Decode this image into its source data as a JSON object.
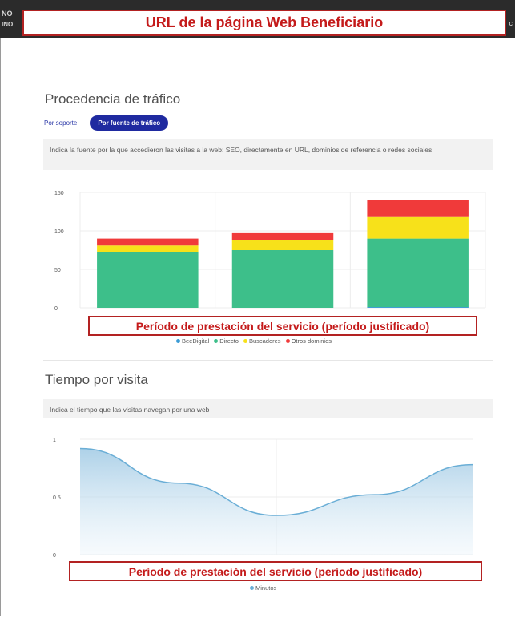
{
  "header": {
    "edge_left_top": "NO",
    "edge_left_bottom": "INO",
    "edge_right": "c",
    "url_banner": "URL de la página Web Beneficiario"
  },
  "traffic": {
    "title": "Procedencia de tráfico",
    "tabs": [
      {
        "label": "Por soporte",
        "active": false
      },
      {
        "label": "Por fuente de tráfico",
        "active": true
      }
    ],
    "info": "Indica la fuente por la que accedieron las visitas a la web: SEO, directamente en URL, dominios de referencia o redes sociales",
    "period_banner": "Período de prestación del servicio (período justificado)"
  },
  "visit_time": {
    "title": "Tiempo por visita",
    "info": "Indica el tiempo que las visitas navegan por una web",
    "period_banner": "Período de prestación del servicio (período justificado)"
  },
  "colors": {
    "accent": "#1f2aa0",
    "banner_red": "#c41a1a",
    "green": "#3dbf8a",
    "yellow": "#f7e11a",
    "red": "#f03a3a",
    "blue": "#3a9bd5",
    "area_line": "#6aaed6"
  },
  "chart_data": [
    {
      "type": "bar",
      "stacked": true,
      "categories": [
        "",
        "",
        ""
      ],
      "series": [
        {
          "name": "BeeDigital",
          "color": "#3a9bd5",
          "values": [
            0,
            0,
            1
          ]
        },
        {
          "name": "Directo",
          "color": "#3dbf8a",
          "values": [
            72,
            75,
            89
          ]
        },
        {
          "name": "Buscadores",
          "color": "#f7e11a",
          "values": [
            9,
            13,
            28
          ]
        },
        {
          "name": "Otros dominios",
          "color": "#f03a3a",
          "values": [
            9,
            9,
            22
          ]
        }
      ],
      "ylim": [
        0,
        150
      ],
      "yticks": [
        0,
        50,
        100,
        150
      ],
      "grid": true,
      "legend": "bottom"
    },
    {
      "type": "area",
      "x": [
        0,
        0.25,
        0.5,
        0.75,
        1
      ],
      "series": [
        {
          "name": "Minutos",
          "color": "#6aaed6",
          "values": [
            0.92,
            0.62,
            0.34,
            0.52,
            0.78
          ]
        }
      ],
      "ylim": [
        0,
        1
      ],
      "yticks": [
        0,
        0.5,
        1
      ],
      "grid": true,
      "legend": "bottom"
    }
  ]
}
